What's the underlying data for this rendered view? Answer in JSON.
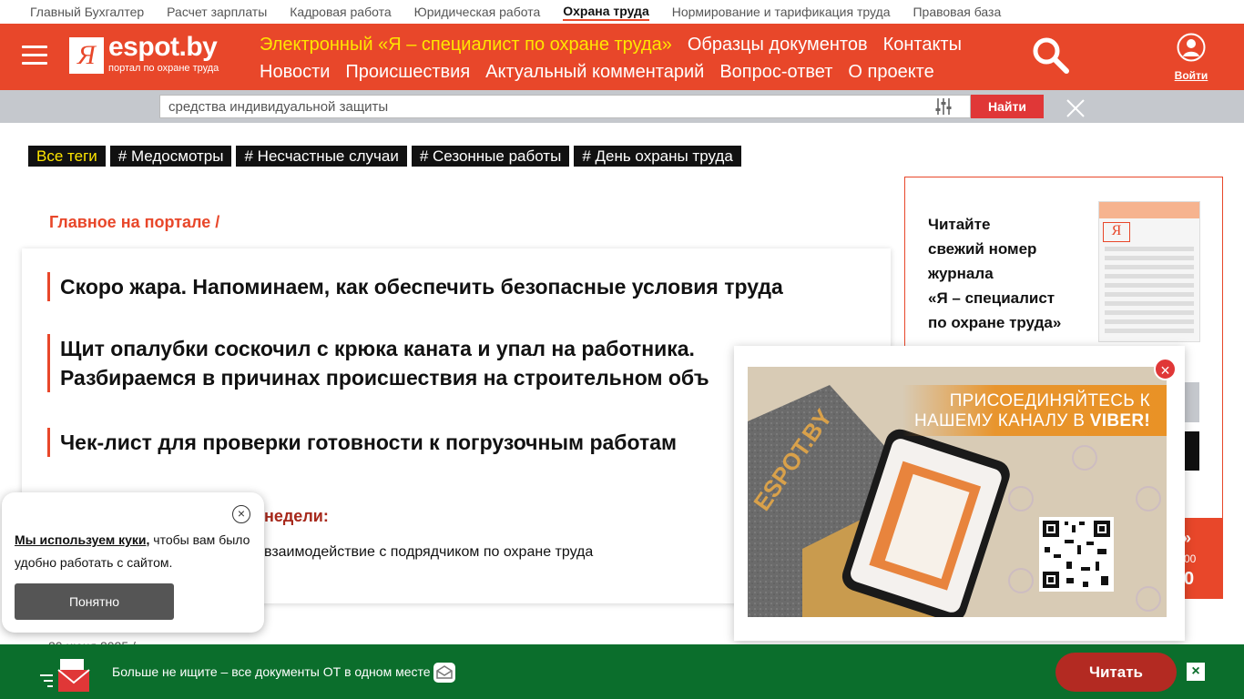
{
  "topnav": {
    "items": [
      "Главный Бухгалтер",
      "Расчет зарплаты",
      "Кадровая работа",
      "Юридическая работа",
      "Охрана труда",
      "Нормирование и тарификация труда",
      "Правовая база"
    ],
    "active_index": 4
  },
  "header": {
    "logo_letter": "Я",
    "logo_text": "espot.by",
    "logo_sub": "портал по охране труда",
    "nav_row1": [
      "Электронный «Я – специалист по охране труда»",
      "Образцы документов",
      "Контакты"
    ],
    "nav_row2": [
      "Новости",
      "Происшествия",
      "Актуальный комментарий",
      "Вопрос-ответ",
      "О проекте"
    ],
    "login_label": "Войти",
    "highlight_color": "#ffe600",
    "brand_color": "#e8472a"
  },
  "search": {
    "value": "средства индивидуальной защиты",
    "button_label": "Найти"
  },
  "tags": [
    "Все теги",
    "# Медосмотры",
    "# Несчастные случаи",
    "# Сезонные работы",
    "# День охраны труда"
  ],
  "main": {
    "breadcrumb": "Главное на портале /",
    "news": [
      {
        "line1": "Скоро жара. Напоминаем, как обеспечить безопасные условия труда",
        "line2": ""
      },
      {
        "line1": "Щит опалубки соскочил с крюка каната и упал на работника.",
        "line2": "Разбираемся в причинах происшествия на строительном объ"
      },
      {
        "line1": "Чек-лист для проверки готовности к погрузочным работам",
        "line2": ""
      }
    ],
    "week_title": "недели:",
    "week_item": "взаимодействие с подрядчиком по охране труда",
    "date": "20 июня 2025 /"
  },
  "promo": {
    "text_lines": [
      "Читайте",
      "свежий номер",
      "журнала",
      "«Я – специалист",
      "по охране труда»"
    ],
    "mag_logo": "Я",
    "right_orange_text": "00"
  },
  "viber": {
    "caption_line1": "ПРИСОЕДИНЯЙТЕСЬ К",
    "caption_line2": "НАШЕМУ КАНАЛУ В",
    "caption_brand": "VIBER!",
    "tile_text": "ESPOT.BY",
    "close_label": "×"
  },
  "cookie": {
    "link_text": "Мы используем куки,",
    "text": " чтобы вам было удобно работать с сайтом.",
    "button_label": "Понятно"
  },
  "bottombar": {
    "text": "Больше не ищите – все документы ОТ в одном месте",
    "button_label": "Читать",
    "close_label": "×"
  }
}
